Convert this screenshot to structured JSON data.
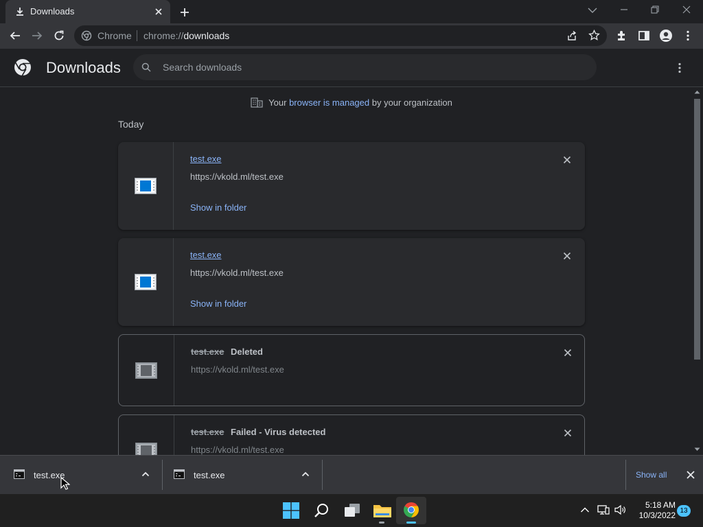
{
  "browser": {
    "tab_title": "Downloads",
    "omnibox_site_label": "Chrome",
    "omnibox_url_prefix": "chrome://",
    "omnibox_url_page": "downloads"
  },
  "downloads_page": {
    "title": "Downloads",
    "search_placeholder": "Search downloads",
    "managed_notice": {
      "prefix": "Your ",
      "link": "browser is managed",
      "suffix": " by your organization"
    },
    "section_title": "Today",
    "items": [
      {
        "file_name": "test.exe",
        "url": "https://vkold.ml/test.exe",
        "action": "Show in folder",
        "status": ""
      },
      {
        "file_name": "test.exe",
        "url": "https://vkold.ml/test.exe",
        "action": "Show in folder",
        "status": ""
      },
      {
        "file_name": "test.exe",
        "url": "https://vkold.ml/test.exe",
        "action": "",
        "status": "Deleted"
      },
      {
        "file_name": "test.exe",
        "url": "https://vkold.ml/test.exe",
        "action": "",
        "status": "Failed - Virus detected"
      }
    ]
  },
  "download_shelf": {
    "items": [
      {
        "file_name": "test.exe"
      },
      {
        "file_name": "test.exe"
      }
    ],
    "show_all_label": "Show all"
  },
  "taskbar": {
    "time": "5:18 AM",
    "date": "10/3/2022",
    "notification_count": "13"
  },
  "colors": {
    "link_blue": "#8ab4f8",
    "page_bg": "#202124",
    "toolbar_bg": "#35363a",
    "chrome_red": "#ea4335",
    "chrome_green": "#34a853",
    "chrome_yellow": "#fbbc04",
    "chrome_blue": "#4285f4"
  }
}
